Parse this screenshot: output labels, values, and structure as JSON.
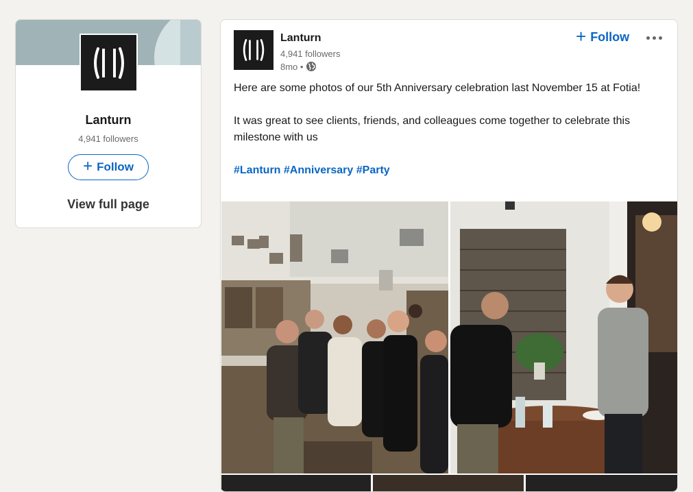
{
  "sidebar_card": {
    "company_name": "Lanturn",
    "followers": "4,941 followers",
    "follow_label": "Follow",
    "view_full_page_label": "View full page"
  },
  "post": {
    "author": "Lanturn",
    "followers": "4,941 followers",
    "time": "8mo •",
    "follow_label": "Follow",
    "text_line_1": "Here are some photos of our 5th Anniversary celebration last November 15 at Fotia!",
    "text_line_2": "It was great to see clients, friends, and colleagues come together to celebrate this milestone with us",
    "hashtags": [
      "#Lanturn",
      "#Anniversary",
      "#Party"
    ]
  },
  "icons": {
    "plus": "plus-icon",
    "more": "ellipsis-icon",
    "visibility": "globe-icon",
    "logo": "lanturn-logo"
  },
  "colors": {
    "accent": "#0a66c2",
    "page_bg": "#f3f2ef",
    "logo_bg": "#1b1b1b"
  }
}
